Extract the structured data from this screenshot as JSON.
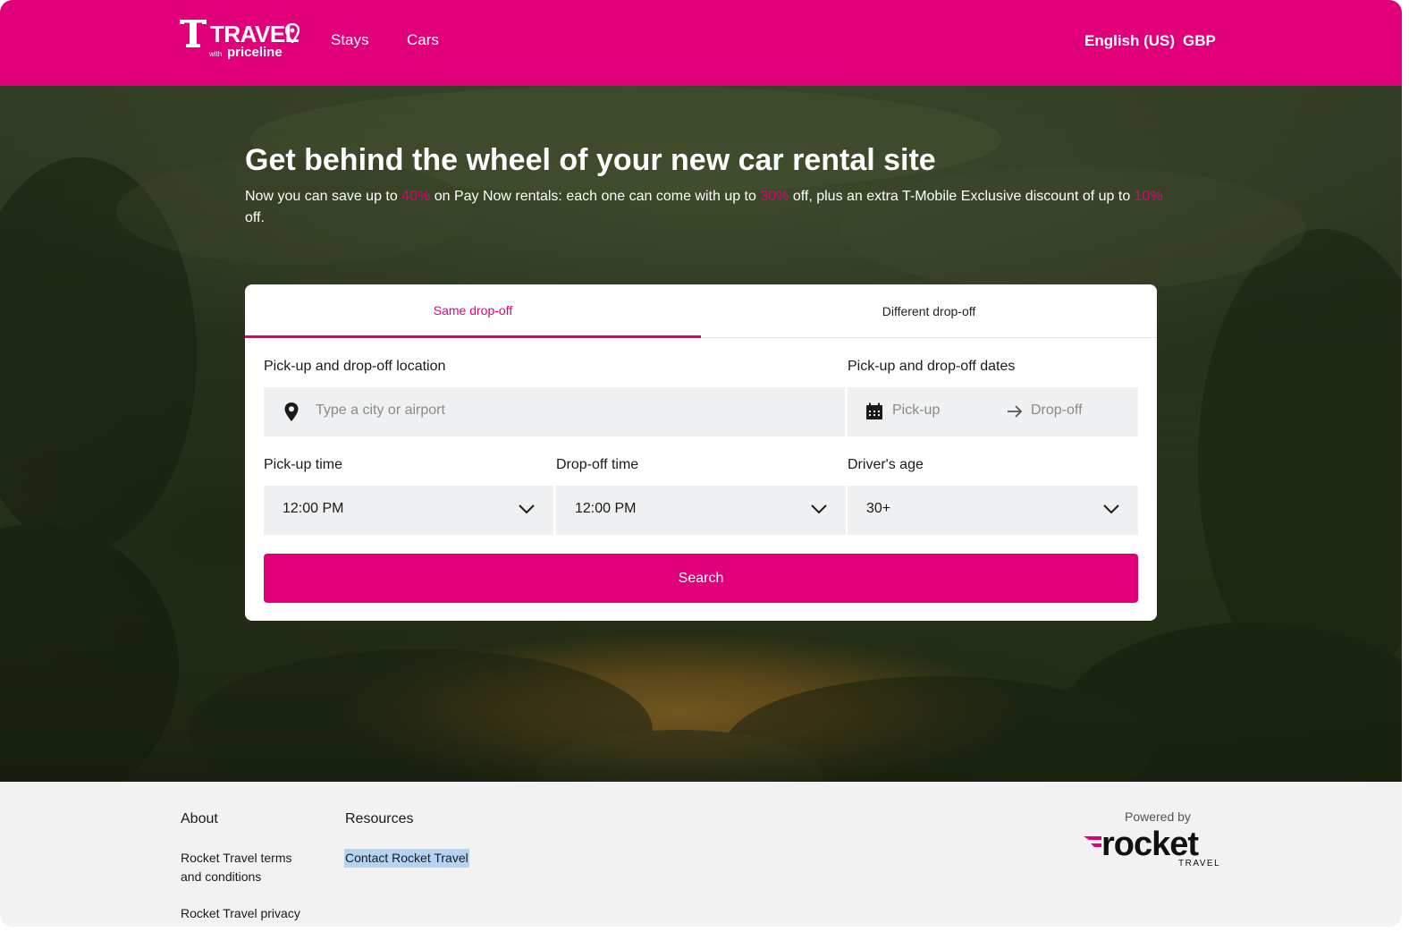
{
  "header": {
    "logo": {
      "brand": "TRAVEL",
      "with": "with",
      "partner": "priceline"
    },
    "nav": {
      "stays": "Stays",
      "cars": "Cars"
    },
    "language": "English (US)",
    "currency": "GBP"
  },
  "hero": {
    "title": "Get behind the wheel of your new car rental site",
    "subtitle": {
      "part1": "Now you can save up to ",
      "pct1": "40%",
      "part2": " on Pay Now rentals: each one can come with up to ",
      "pct2": "30%",
      "part3": " off, plus an extra T-Mobile Exclusive discount of up to ",
      "pct3": "10%",
      "part4": " off."
    }
  },
  "search": {
    "tabs": {
      "same": "Same drop-off",
      "different": "Different drop-off"
    },
    "location": {
      "label": "Pick-up and drop-off location",
      "placeholder": "Type a city or airport"
    },
    "dates": {
      "label": "Pick-up and drop-off dates",
      "pickup": "Pick-up",
      "dropoff": "Drop-off"
    },
    "pickup_time": {
      "label": "Pick-up time",
      "value": "12:00 PM"
    },
    "dropoff_time": {
      "label": "Drop-off time",
      "value": "12:00 PM"
    },
    "driver_age": {
      "label": "Driver's age",
      "value": "30+"
    },
    "button": "Search"
  },
  "footer": {
    "about": {
      "heading": "About",
      "terms_line1": "Rocket Travel terms",
      "terms_line2": "and conditions",
      "privacy": "Rocket Travel privacy"
    },
    "resources": {
      "heading": "Resources",
      "contact": "Contact Rocket Travel"
    },
    "powered_by": "Powered by",
    "rocket_logo": {
      "name": "rocket",
      "sub": "TRAVEL"
    }
  },
  "colors": {
    "brand": "#e2007a",
    "field_bg": "#eef0f1",
    "footer_bg": "#f2f2f2"
  }
}
